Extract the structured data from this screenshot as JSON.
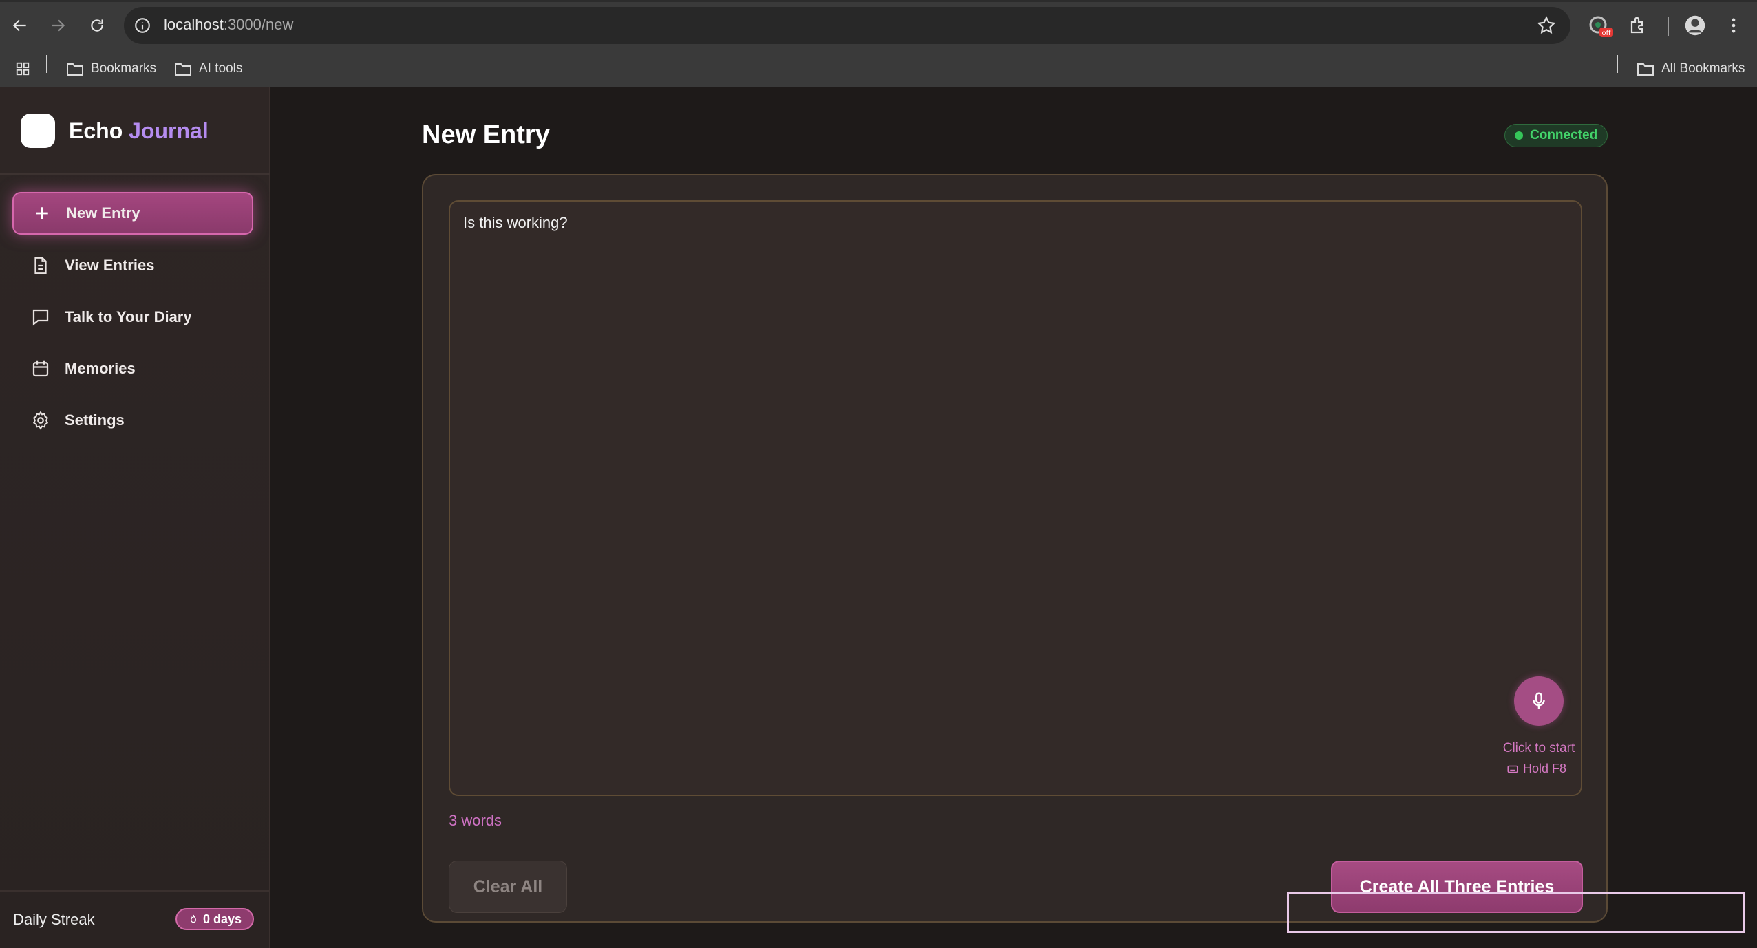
{
  "browser": {
    "url_host": "localhost",
    "url_path": ":3000/new",
    "bookmarks": [
      {
        "label": "Bookmarks"
      },
      {
        "label": "AI tools"
      }
    ],
    "all_bookmarks_label": "All Bookmarks",
    "extension_badge": "off"
  },
  "sidebar": {
    "brand_first": "Echo",
    "brand_second": "Journal",
    "items": [
      {
        "label": "New Entry",
        "icon": "plus-icon",
        "active": true
      },
      {
        "label": "View Entries",
        "icon": "document-icon",
        "active": false
      },
      {
        "label": "Talk to Your Diary",
        "icon": "chat-bubble-icon",
        "active": false
      },
      {
        "label": "Memories",
        "icon": "calendar-icon",
        "active": false
      },
      {
        "label": "Settings",
        "icon": "gear-icon",
        "active": false
      }
    ],
    "streak_label": "Daily Streak",
    "streak_value": "0 days"
  },
  "main": {
    "title": "New Entry",
    "connection_status": "Connected",
    "editor_text": "Is this working?",
    "mic_hint": "Click to start",
    "mic_shortcut": "Hold F8",
    "word_count": "3 words",
    "clear_label": "Clear All",
    "create_label": "Create All Three Entries"
  },
  "colors": {
    "accent": "#a44d84",
    "accent_border": "#d667ad",
    "brand_accent": "#b58cf0",
    "connected": "#43d46a"
  }
}
